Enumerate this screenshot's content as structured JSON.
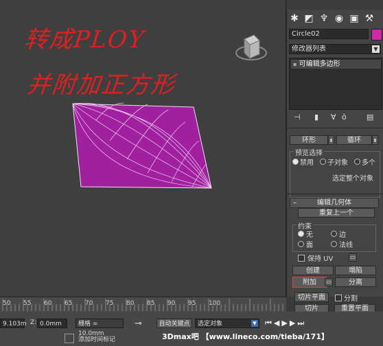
{
  "annotation": {
    "line1": "转成PLOY",
    "line2": "并附加正方形"
  },
  "panel": {
    "object_name": "Circle02",
    "modifier_list": "修改器列表",
    "stack_item": "可编辑多边形",
    "ring_label": "环形",
    "loop_label": "循环",
    "preview_group": "预览选择",
    "preview_options": [
      "禁用",
      "子对象",
      "多个"
    ],
    "select_whole": "选定整个对象",
    "edit_geometry_title": "编辑几何体",
    "repeat_last": "重复上一个",
    "constraint_group": "约束",
    "constraints": [
      "无",
      "边",
      "面",
      "法线"
    ],
    "preserve_uv": "保持 UV",
    "create": "创建",
    "collapse": "塌陷",
    "attach": "附加",
    "detach": "分离",
    "slice_plane": "切片平面",
    "split": "分割",
    "slice": "切片",
    "reset_plane": "重置平面"
  },
  "timeline": {
    "ticks": [
      "50",
      "55",
      "60",
      "65",
      "70",
      "75",
      "80",
      "85",
      "90",
      "95",
      "100"
    ]
  },
  "status": {
    "x_value": "9.103m",
    "z_label": "Z:",
    "z_value": "0.0mm",
    "grid_label": "栅格 = 10.0mm",
    "auto_key": "自动关键点",
    "selected_object": "选定对象",
    "add_time_tag": "添加时间标记",
    "watermark": "3Dmax吧 【www.lineco.com/tieba/171】"
  },
  "colors": {
    "object": "#a020a0",
    "annotation": "#e02020",
    "swatch": "#cc2aa8"
  }
}
